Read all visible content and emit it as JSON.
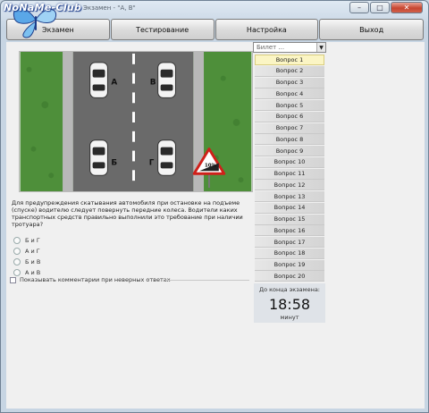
{
  "window": {
    "title": "Экзамен - \"А, В\"",
    "minimize_glyph": "–",
    "maximize_glyph": "□",
    "close_glyph": "✕"
  },
  "logo": {
    "text": "NoNaMe-Club"
  },
  "tabs": [
    {
      "label": "Экзамен"
    },
    {
      "label": "Тестирование"
    },
    {
      "label": "Настройка"
    },
    {
      "label": "Выход"
    }
  ],
  "scene": {
    "car_labels": [
      "А",
      "В",
      "Б",
      "Г"
    ],
    "sign_text": "10%"
  },
  "question": {
    "text": "Для предупреждения скатывания автомобиля при остановке на подъеме (спуске) водителю следует повернуть передние колеса. Водители каких транспортных средств правильно выполнили это требование при наличии тротуара?",
    "options": [
      "Б и Г",
      "А и Г",
      "Б и В",
      "А и В"
    ],
    "show_comments_label": "Показывать комментарии при неверных ответах"
  },
  "ticket_select": {
    "placeholder": "Билет ..."
  },
  "question_list": [
    {
      "label": "Вопрос 1",
      "active": true
    },
    {
      "label": "Вопрос 2"
    },
    {
      "label": "Вопрос 3"
    },
    {
      "label": "Вопрос 4"
    },
    {
      "label": "Вопрос 5"
    },
    {
      "label": "Вопрос 6"
    },
    {
      "label": "Вопрос 7"
    },
    {
      "label": "Вопрос 8"
    },
    {
      "label": "Вопрос 9"
    },
    {
      "label": "Вопрос 10"
    },
    {
      "label": "Вопрос 11"
    },
    {
      "label": "Вопрос 12"
    },
    {
      "label": "Вопрос 13"
    },
    {
      "label": "Вопрос 14"
    },
    {
      "label": "Вопрос 15"
    },
    {
      "label": "Вопрос 16"
    },
    {
      "label": "Вопрос 17"
    },
    {
      "label": "Вопрос 18"
    },
    {
      "label": "Вопрос 19"
    },
    {
      "label": "Вопрос 20"
    }
  ],
  "timer": {
    "label": "До конца экзамена:",
    "value": "18:58",
    "unit": "минут"
  },
  "colors": {
    "active_question_bg": "#fbf5c4",
    "grass": "#4e8f3a",
    "road": "#6a6a6a",
    "sign_red": "#d0201a"
  }
}
